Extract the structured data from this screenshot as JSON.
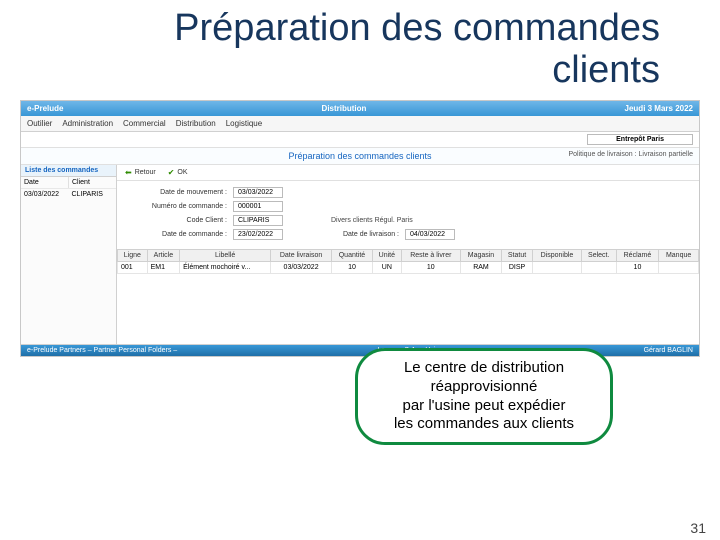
{
  "slide": {
    "title": "Préparation des commandes clients",
    "page_number": "31"
  },
  "app": {
    "brand": "e-Prelude",
    "module": "Distribution",
    "date": "Jeudi 3 Mars 2022",
    "menu": [
      "Outilier",
      "Administration",
      "Commercial",
      "Distribution",
      "Logistique"
    ],
    "context_depot": "Entrepôt Paris",
    "page_title": "Préparation des commandes clients",
    "page_right": "Politique de livraison : Livraison partielle"
  },
  "left": {
    "title": "Liste des commandes",
    "headers": [
      "Date",
      "Client"
    ],
    "row": [
      "03/03/2022",
      "CLIPARIS"
    ]
  },
  "toolbar": {
    "back": "Retour",
    "ok": "OK"
  },
  "form": {
    "date_mvt_label": "Date de mouvement :",
    "date_mvt": "03/03/2022",
    "num_label": "Numéro de commande :",
    "num": "000001",
    "client_label": "Code Client :",
    "client": "CLIPARIS",
    "client_name": "Divers clients Régul.  Paris",
    "date_cmd_label": "Date de commande :",
    "date_cmd": "23/02/2022",
    "date_liv_label": "Date de livraison :",
    "date_liv": "04/03/2022"
  },
  "grid": {
    "headers": [
      "Ligne",
      "Article",
      "Libellé",
      "Date livraison",
      "Quantité",
      "Unité",
      "Reste à livrer",
      "Magasin",
      "Statut",
      "Disponible",
      "Select.",
      "Réclamé",
      "Manque"
    ],
    "row": [
      "001",
      "EM1",
      "Élément mochoiré v...",
      "03/03/2022",
      "10",
      "UN",
      "10",
      "RAM",
      "DISP",
      "",
      "",
      "10",
      ""
    ]
  },
  "footer": {
    "left": "e-Prelude Partners – Partner Personal Folders –",
    "center": "Lecerve S.A. – Usine",
    "right": "Gérard BAGLIN"
  },
  "annotation": {
    "line1": "Le centre de distribution",
    "line2": "réapprovisionné",
    "line3": "par l'usine peut expédier",
    "line4": "les commandes aux clients"
  }
}
